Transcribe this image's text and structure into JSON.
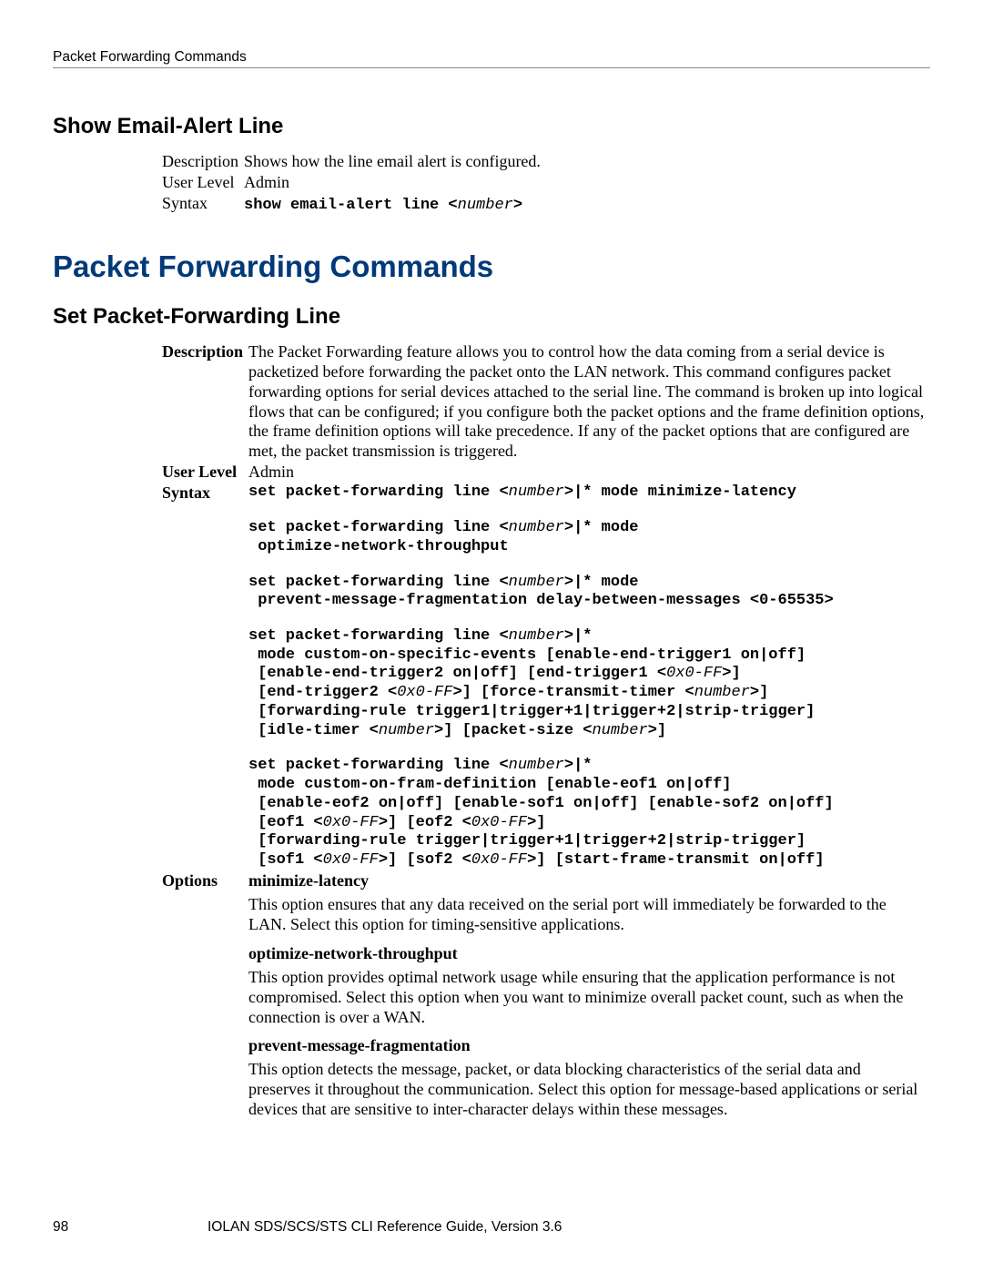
{
  "running_header": "Packet Forwarding Commands",
  "section_email": {
    "heading": "Show Email-Alert Line",
    "description_label": "Description",
    "description": "Shows how the line email alert is configured.",
    "userlevel_label": "User Level",
    "userlevel": "Admin",
    "syntax_label": "Syntax",
    "syntax_pre": "show email-alert line <",
    "syntax_param": "number",
    "syntax_post": ">"
  },
  "chapter_title": "Packet Forwarding Commands",
  "section_pf": {
    "heading": "Set Packet-Forwarding Line",
    "description_label": "Description",
    "description": "The Packet Forwarding feature allows you to control how the data coming from a serial device is packetized before forwarding the packet onto the LAN network. This command configures packet forwarding options for serial devices attached to the serial line. The command is broken up into logical flows that can be configured; if you configure both the packet options and the frame definition options, the frame definition options will take precedence. If any of the packet options that are configured are met, the packet transmission is triggered.",
    "userlevel_label": "User Level",
    "userlevel": "Admin",
    "syntax_label": "Syntax",
    "options_label": "Options",
    "syntax1_a": "set packet-forwarding line <",
    "syntax1_b": ">|* mode minimize-latency",
    "syntax2_a": "set packet-forwarding line <",
    "syntax2_b": ">|* mode",
    "syntax2_c": " optimize-network-throughput",
    "syntax3_a": "set packet-forwarding line <",
    "syntax3_b": ">|* mode",
    "syntax3_c": " prevent-message-fragmentation delay-between-messages <0-65535>",
    "syntax4_a": "set packet-forwarding line <",
    "syntax4_b": ">|*",
    "syntax4_c": " mode custom-on-specific-events [enable-end-trigger1 on|off]",
    "syntax4_d": " [enable-end-trigger2 on|off] [end-trigger1 <",
    "syntax4_e": ">]",
    "syntax4_f": " [end-trigger2 <",
    "syntax4_g": ">] [force-transmit-timer <",
    "syntax4_h": ">]",
    "syntax4_i": " [forwarding-rule trigger1|trigger+1|trigger+2|strip-trigger]",
    "syntax4_j": " [idle-timer <",
    "syntax4_k": ">] [packet-size <",
    "syntax4_l": ">]",
    "syntax5_a": "set packet-forwarding line <",
    "syntax5_b": ">|*",
    "syntax5_c": " mode custom-on-fram-definition [enable-eof1 on|off]",
    "syntax5_d": " [enable-eof2 on|off] [enable-sof1 on|off] [enable-sof2 on|off]",
    "syntax5_e": " [eof1 <",
    "syntax5_f": ">] [eof2 <",
    "syntax5_g": ">]",
    "syntax5_h": " [forwarding-rule trigger|trigger+1|trigger+2|strip-trigger]",
    "syntax5_i": " [sof1 <",
    "syntax5_j": ">] [sof2 <",
    "syntax5_k": ">] [start-frame-transmit on|off]",
    "p_number": "number",
    "p_hex": "0x0-FF",
    "options": [
      {
        "name": "minimize-latency",
        "desc": "This option ensures that any data received on the serial port will immediately be forwarded to the LAN. Select this option for timing-sensitive applications."
      },
      {
        "name": "optimize-network-throughput",
        "desc": "This option provides optimal network usage while ensuring that the application performance is not compromised. Select this option when you want to minimize overall packet count, such as when the connection is over a WAN."
      },
      {
        "name": "prevent-message-fragmentation",
        "desc": "This option detects the message, packet, or data blocking characteristics of the serial data and preserves it throughout the communication. Select this option for message-based applications or serial devices that are sensitive to inter-character delays within these messages."
      }
    ]
  },
  "footer": {
    "page": "98",
    "title": "IOLAN SDS/SCS/STS CLI Reference Guide, Version 3.6"
  }
}
